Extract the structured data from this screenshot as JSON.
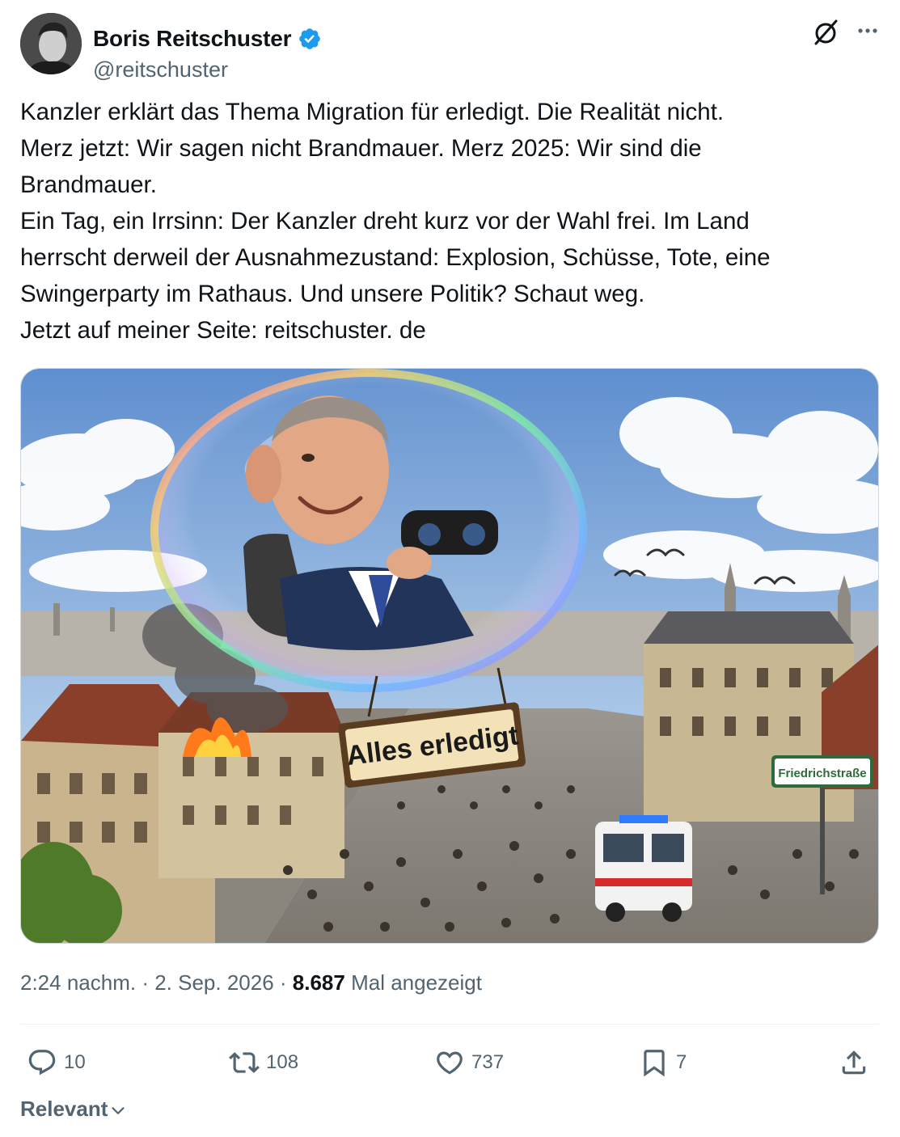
{
  "author": {
    "name": "Boris Reitschuster",
    "handle": "@reitschuster",
    "verified": true,
    "verified_color": "#1d9bf0"
  },
  "icons": {
    "grok": "grok-icon",
    "more": "more-options-icon"
  },
  "tweet": {
    "lines": [
      "Kanzler erklärt das Thema Migration für erledigt. Die Realität nicht.",
      "Merz jetzt: Wir sagen nicht Brandmauer. Merz 2025: Wir sind die",
      "Brandmauer.",
      "Ein Tag, ein Irrsinn: Der Kanzler dreht kurz vor der Wahl frei. Im Land",
      "herrscht derweil der Ausnahmezustand: Explosion, Schüsse, Tote, eine",
      "Swingerparty im Rathaus. Und unsere Politik? Schaut weg.",
      "Jetzt auf meiner Seite: reitschuster. de"
    ]
  },
  "image": {
    "sign_text": "Alles erledigt",
    "street_sign_text": "Friedrichstraße"
  },
  "meta": {
    "time": "2:24 nachm.",
    "sep1": " · ",
    "date": "2. Sep. 2026",
    "sep2": " · ",
    "views": "8.687",
    "views_label": " Mal angezeigt"
  },
  "actions": {
    "replies": "10",
    "reposts": "108",
    "likes": "737",
    "bookmarks": "7"
  },
  "sort": {
    "label": "Relevant"
  },
  "colors": {
    "text": "#0f1419",
    "secondary": "#536471",
    "accent": "#1d9bf0"
  }
}
